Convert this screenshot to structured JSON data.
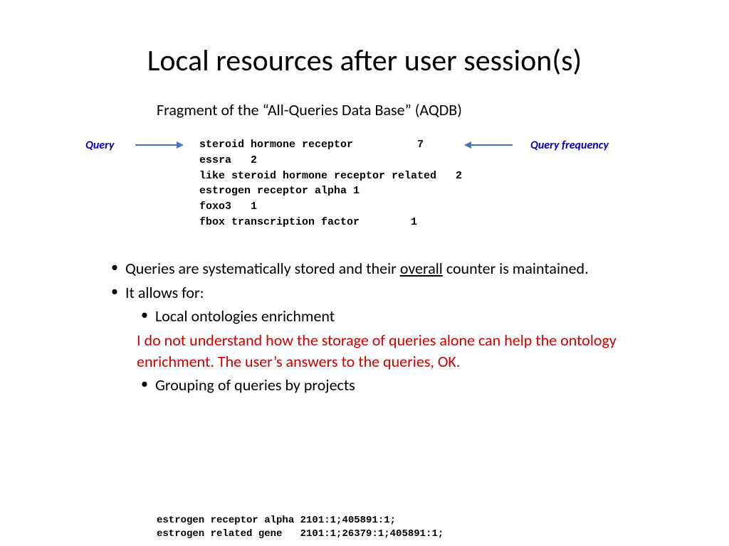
{
  "title": "Local resources after user session(s)",
  "subtitle": "Fragment of the “All-Queries Data Base” (AQDB)",
  "labels": {
    "query": "Query",
    "queryFrequency": "Query frequency"
  },
  "queries": {
    "line1": "steroid hormone receptor          7",
    "line2": "essra   2",
    "line3": "like steroid hormone receptor related   2",
    "line4": "estrogen receptor alpha 1",
    "line5": "foxo3   1",
    "line6": "fbox transcription factor        1"
  },
  "bullets": {
    "b1_pre": "Queries are systematically stored and their ",
    "b1_underlined": "overall",
    "b1_post": " counter is maintained.",
    "b2": "It allows for:",
    "b2a": "Local ontologies enrichment",
    "note": "I do not understand how the storage of queries alone can help the ontology enrichment. The user’s answers to the queries, OK.",
    "b2b": "Grouping of queries by projects"
  },
  "bottomBlock": {
    "line1": "estrogen receptor alpha 2101:1;405891:1;",
    "line2": "estrogen related gene   2101:1;26379:1;405891:1;"
  }
}
